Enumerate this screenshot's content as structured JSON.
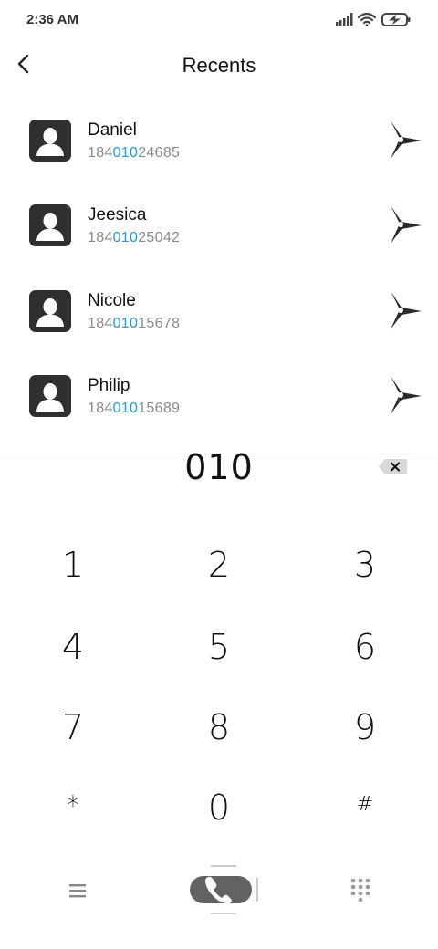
{
  "status_bar": {
    "time": "2:36 AM",
    "icons": [
      "signal-icon",
      "wifi-icon",
      "battery-charging-icon"
    ]
  },
  "header": {
    "title": "Recents",
    "back_icon": "chevron-left-icon"
  },
  "contacts": [
    {
      "name": "Daniel",
      "number_prefix": "184",
      "number_match": "010",
      "number_suffix": "24685"
    },
    {
      "name": "Jeesica",
      "number_prefix": "184",
      "number_match": "010",
      "number_suffix": "25042"
    },
    {
      "name": "Nicole",
      "number_prefix": "184",
      "number_match": "010",
      "number_suffix": "15678"
    },
    {
      "name": "Philip",
      "number_prefix": "184",
      "number_match": "010",
      "number_suffix": "15689"
    }
  ],
  "dialer": {
    "input": "010",
    "keys": [
      "1",
      "2",
      "3",
      "4",
      "5",
      "6",
      "7",
      "8",
      "9",
      "*",
      "0",
      "#"
    ]
  },
  "bottom_bar": {
    "menu_icon": "menu-icon",
    "call_icon": "phone-icon",
    "keypad_icon": "dialpad-icon"
  },
  "colors": {
    "match_highlight": "#1e9bd7",
    "avatar_bg": "#2f2f2f",
    "call_button": "#555555"
  }
}
